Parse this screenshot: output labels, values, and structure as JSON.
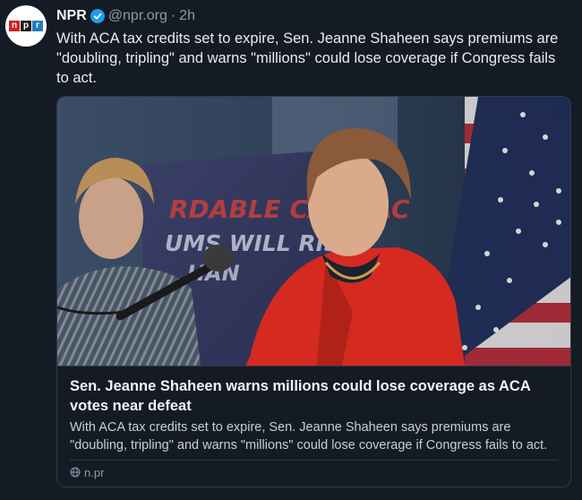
{
  "post": {
    "author_name": "NPR",
    "author_handle": "@npr.org",
    "separator": "·",
    "timestamp": "2h",
    "text": "With ACA tax credits set to expire, Sen. Jeanne Shaheen says premiums are \"doubling, tripling\" and warns \"millions\" could lose coverage if Congress fails to act."
  },
  "avatar": {
    "logo_letters": [
      "n",
      "p",
      "r"
    ]
  },
  "link_card": {
    "title": "Sen. Jeanne Shaheen warns millions could lose coverage as ACA votes near defeat",
    "description": "With ACA tax credits set to expire, Sen. Jeanne Shaheen says premiums are \"doubling, tripling\" and warns \"millions\" could lose coverage if Congress fails to act.",
    "domain": "n.pr",
    "image_sign_lines": [
      "RDABLE CARE AC",
      "UMS WILL RISE",
      "HAN"
    ]
  },
  "colors": {
    "background": "#151b24",
    "verified_blue": "#1d9bf0",
    "npr_red": "#d62021",
    "npr_black": "#1d1d1d",
    "npr_blue": "#237bbd",
    "jacket_red": "#d42a20"
  },
  "icons": {
    "verified": "verified-badge-icon",
    "domain": "globe-icon"
  }
}
